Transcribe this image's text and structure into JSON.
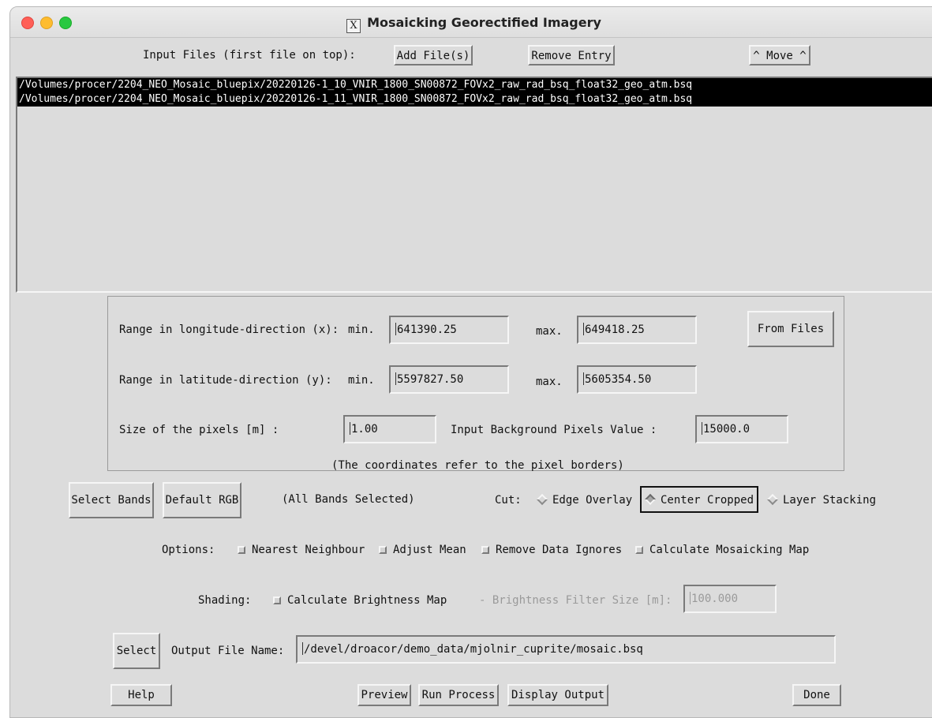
{
  "window": {
    "title": "Mosaicking Georectified Imagery",
    "traffic_lights": {
      "close": "#ff5f57",
      "minimize": "#febc2e",
      "zoom": "#28c840"
    }
  },
  "input": {
    "label": "Input Files (first file on top):",
    "add_label": "Add File(s)",
    "remove_label": "Remove Entry",
    "move_label": "^ Move ^",
    "files": [
      "/Volumes/procer/2204_NEO_Mosaic_bluepix/20220126-1_10_VNIR_1800_SN00872_FOVx2_raw_rad_bsq_float32_geo_atm.bsq",
      "/Volumes/procer/2204_NEO_Mosaic_bluepix/20220126-1_11_VNIR_1800_SN00872_FOVx2_raw_rad_bsq_float32_geo_atm.bsq"
    ]
  },
  "range": {
    "lon_label": "Range in longitude-direction (x):",
    "lat_label": "Range in latitude-direction (y):",
    "min_label": "min.",
    "max_label": "max.",
    "lon_min": "641390.25",
    "lon_max": "649418.25",
    "lat_min": "5597827.50",
    "lat_max": "5605354.50",
    "from_files_label": "From Files",
    "pixel_size_label": "Size of the pixels [m] :",
    "pixel_size": "1.00",
    "background_label": "Input Background Pixels Value :",
    "background": "15000.0",
    "note": "(The coordinates refer to the pixel borders)"
  },
  "bands": {
    "select_label": "Select Bands",
    "default_rgb_label": "Default RGB",
    "status": "(All Bands Selected)"
  },
  "cut": {
    "label": "Cut:",
    "options": [
      "Edge Overlay",
      "Center Cropped",
      "Layer Stacking"
    ],
    "selected": "Center Cropped"
  },
  "options": {
    "label": "Options:",
    "items": [
      "Nearest Neighbour",
      "Adjust Mean",
      "Remove Data Ignores",
      "Calculate Mosaicking Map"
    ]
  },
  "shading": {
    "label": "Shading:",
    "brightness_map_label": "Calculate Brightness Map",
    "filter_label": "- Brightness Filter Size [m]:",
    "filter_value": "100.000"
  },
  "output": {
    "select_label": "Select",
    "name_label": "Output File Name:",
    "name_value": "/devel/droacor/demo_data/mjolnir_cuprite/mosaic.bsq"
  },
  "footer": {
    "help_label": "Help",
    "preview_label": "Preview",
    "run_label": "Run Process",
    "display_label": "Display Output",
    "done_label": "Done"
  }
}
